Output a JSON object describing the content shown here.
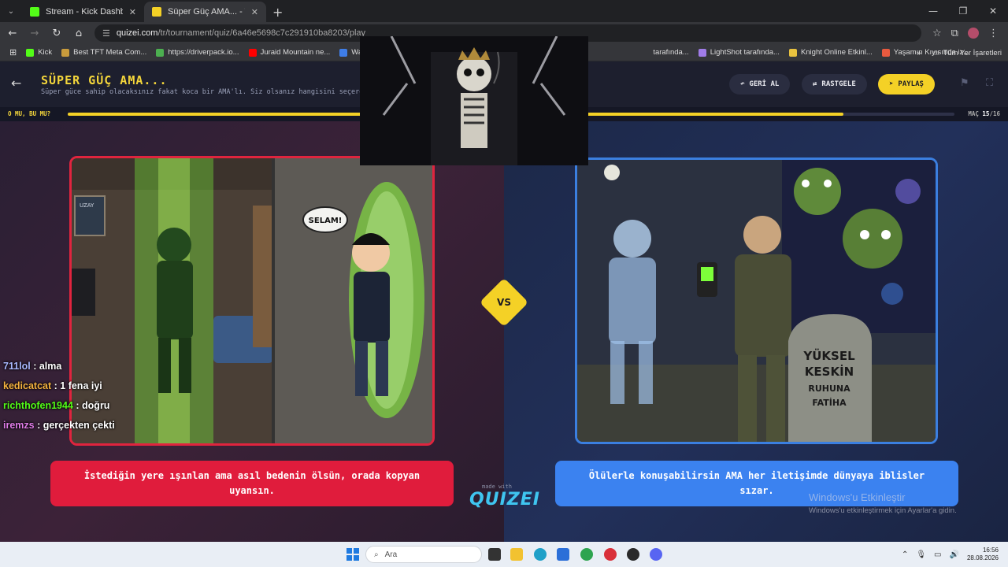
{
  "browser": {
    "tabs": [
      {
        "title": "Stream - Kick Dashboard",
        "favicon_color": "#53fc18"
      },
      {
        "title": "Süper Güç AMA... - Tier List, Ko",
        "favicon_color": "#f4d126"
      }
    ],
    "new_tab_label": "+",
    "url": {
      "host": "quizei.com",
      "path": "/tr/tournament/quiz/6a46e5698c7c291910ba8203/play"
    },
    "bookmarks": [
      {
        "label": "Kick",
        "color": "#53fc18"
      },
      {
        "label": "Best TFT Meta Com...",
        "color": "#c89b3c"
      },
      {
        "label": "https://driverpack.io...",
        "color": "#4caf50"
      },
      {
        "label": "Juraid Mountain ne...",
        "color": "#ff0000"
      },
      {
        "label": "Watch zeytun (",
        "color": "#3f7ee8"
      },
      {
        "label": "tarafında...",
        "color": "#777777"
      },
      {
        "label": "LightShot tarafında...",
        "color": "#a07ce8"
      },
      {
        "label": "Knight Online Etkinl...",
        "color": "#e8c23f"
      },
      {
        "label": "Yaşamın Kıyısında iz...",
        "color": "#e85a3f"
      }
    ],
    "all_bookmarks_label": "Tüm Yer İşaretleri"
  },
  "quiz": {
    "title": "SÜPER GÜÇ AMA...",
    "subtitle": "Süper güce sahip olacaksınız fakat koca bir AMA'lı. Siz olsanız hangisini seçerdini",
    "buttons": {
      "undo": "GERİ AL",
      "random": "RASTGELE",
      "share": "PAYLAŞ"
    },
    "round_label": "O MU, BU MU?",
    "match_label": "MAÇ",
    "match_current": "15",
    "match_total": "/16",
    "progress": 0.875,
    "vs": "VS",
    "left_choice": "İstediğin yere ışınlan ama asıl bedenin ölsün, orada kopyan uyansın.",
    "right_choice": "Ölülerle konuşabilirsin AMA her iletişimde dünyaya iblisler sızar.",
    "left_image_bubble": "SELAM!",
    "left_image_poster": "UZAY",
    "right_image_grave": [
      "YÜKSEL",
      "KESKİN",
      "RUHUNA",
      "FATİHA"
    ],
    "made_with": "made with",
    "brand": "QUIZEI"
  },
  "chat": [
    {
      "user": "711lol",
      "message": "alma",
      "color": "#a9b8ff"
    },
    {
      "user": "kedicatcat",
      "message": "1 fena iyi",
      "color": "#f4b23f"
    },
    {
      "user": "richthofen1944",
      "message": "doğru",
      "color": "#53fc18"
    },
    {
      "user": "iremzs",
      "message": "gerçekten çekti",
      "color": "#e07ce8"
    }
  ],
  "windows_activation": {
    "title": "Windows'u Etkinleştir",
    "detail": "Windows'u etkinleştirmek için Ayarlar'a gidin."
  },
  "taskbar": {
    "search_placeholder": "Ara",
    "time": "16:56",
    "date": "28.08.2026"
  }
}
